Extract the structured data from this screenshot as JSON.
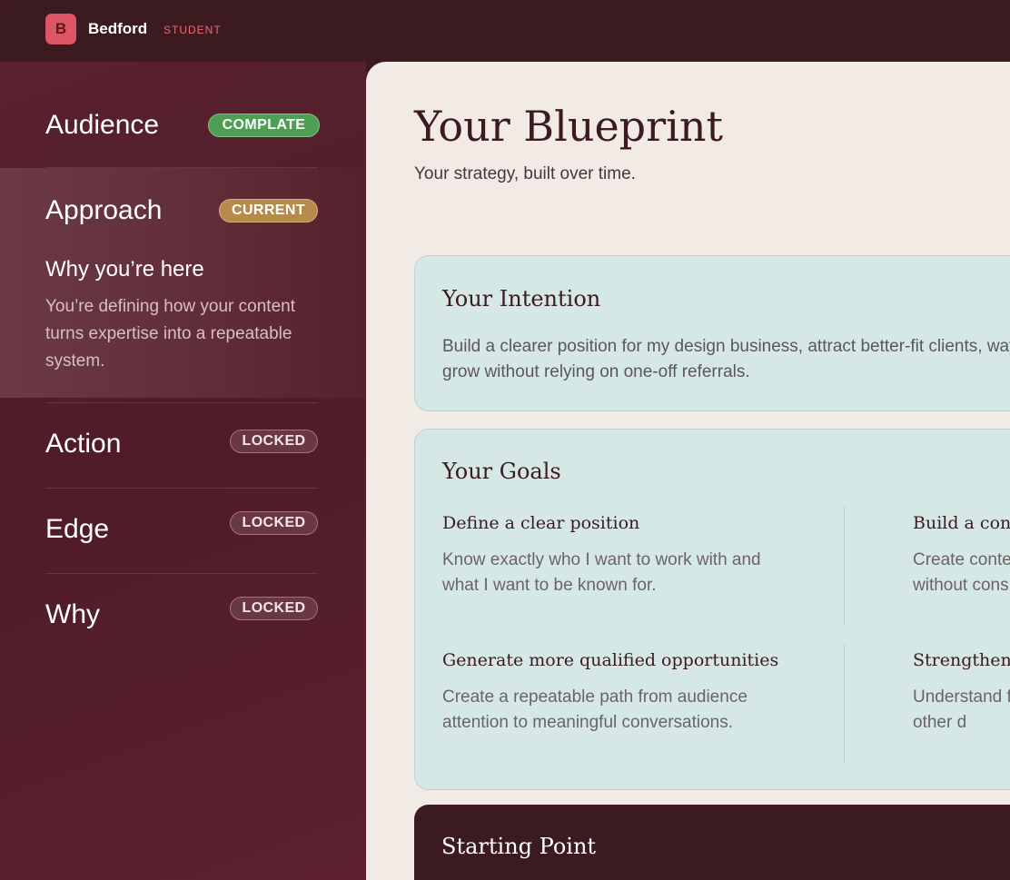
{
  "brand": {
    "logo_letter": "B",
    "name": "Bedford",
    "role": "STUDENT"
  },
  "sidebar": {
    "items": [
      {
        "label": "Audience",
        "badge": "COMPLATE",
        "status": "complete"
      },
      {
        "label": "Approach",
        "badge": "CURRENT",
        "status": "current"
      },
      {
        "label": "Action",
        "badge": "LOCKED",
        "status": "locked"
      },
      {
        "label": "Edge",
        "badge": "LOCKED",
        "status": "locked"
      },
      {
        "label": "Why",
        "badge": "LOCKED",
        "status": "locked"
      }
    ],
    "current_detail": {
      "title": "Why you’re here",
      "body": "You’re defining how your content turns expertise into a repeatable system."
    }
  },
  "main": {
    "title": "Your Blueprint",
    "subtitle": "Your strategy, built over time.",
    "intention": {
      "title": "Your Intention",
      "body": "Build a clearer position for my design business, attract better-fit clients, way to grow without relying on one-off referrals."
    },
    "goals": {
      "title": "Your Goals",
      "items": [
        {
          "title": "Define a clear position",
          "body": "Know exactly who I want to work with and what I want to be known for."
        },
        {
          "title": "Build a cons",
          "body": "Create conte without cons"
        },
        {
          "title": "Generate more qualified opportunities",
          "body": "Create a repeatable path from audience attention to meaningful conversations."
        },
        {
          "title": "Strengthen",
          "body": "Understand from other d"
        }
      ]
    },
    "starting_point": {
      "title": "Starting Point"
    }
  },
  "colors": {
    "topbar": "#3b1a20",
    "accent": "#e05565",
    "complete": "#4e9f55",
    "current": "#b68a4a",
    "card": "#d6e8e6",
    "main_bg": "#f2eae4"
  }
}
